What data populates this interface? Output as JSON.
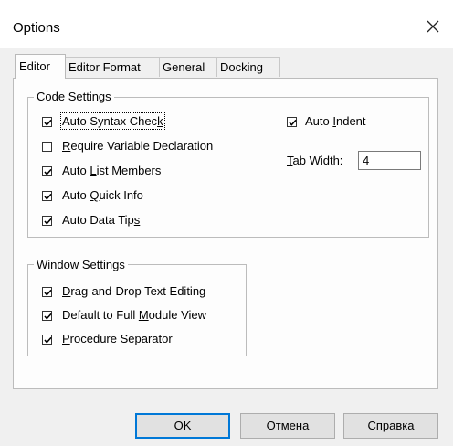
{
  "window": {
    "title": "Options"
  },
  "tabs": [
    {
      "label": "Editor",
      "active": true
    },
    {
      "label": "Editor Format",
      "active": false
    },
    {
      "label": "General",
      "active": false
    },
    {
      "label": "Docking",
      "active": false
    }
  ],
  "code_settings": {
    "legend": "Code Settings",
    "options": [
      {
        "pre": "Auto Syntax Chec",
        "ul": "k",
        "post": "",
        "checked": true
      },
      {
        "pre": "",
        "ul": "R",
        "post": "equire Variable Declaration",
        "checked": false
      },
      {
        "pre": "Auto ",
        "ul": "L",
        "post": "ist Members",
        "checked": true
      },
      {
        "pre": "Auto ",
        "ul": "Q",
        "post": "uick Info",
        "checked": true
      },
      {
        "pre": "Auto Data Tip",
        "ul": "s",
        "post": "",
        "checked": true
      }
    ],
    "auto_indent": {
      "pre": "Auto ",
      "ul": "I",
      "post": "ndent",
      "checked": true
    },
    "tab_width": {
      "ul": "T",
      "post": "ab Width:",
      "value": "4"
    }
  },
  "window_settings": {
    "legend": "Window Settings",
    "options": [
      {
        "pre": "",
        "ul": "D",
        "post": "rag-and-Drop Text Editing",
        "checked": true
      },
      {
        "pre": "Default to Full ",
        "ul": "M",
        "post": "odule View",
        "checked": true
      },
      {
        "pre": "",
        "ul": "P",
        "post": "rocedure Separator",
        "checked": true
      }
    ]
  },
  "buttons": {
    "ok": "OK",
    "cancel": "Отмена",
    "help": "Справка"
  }
}
